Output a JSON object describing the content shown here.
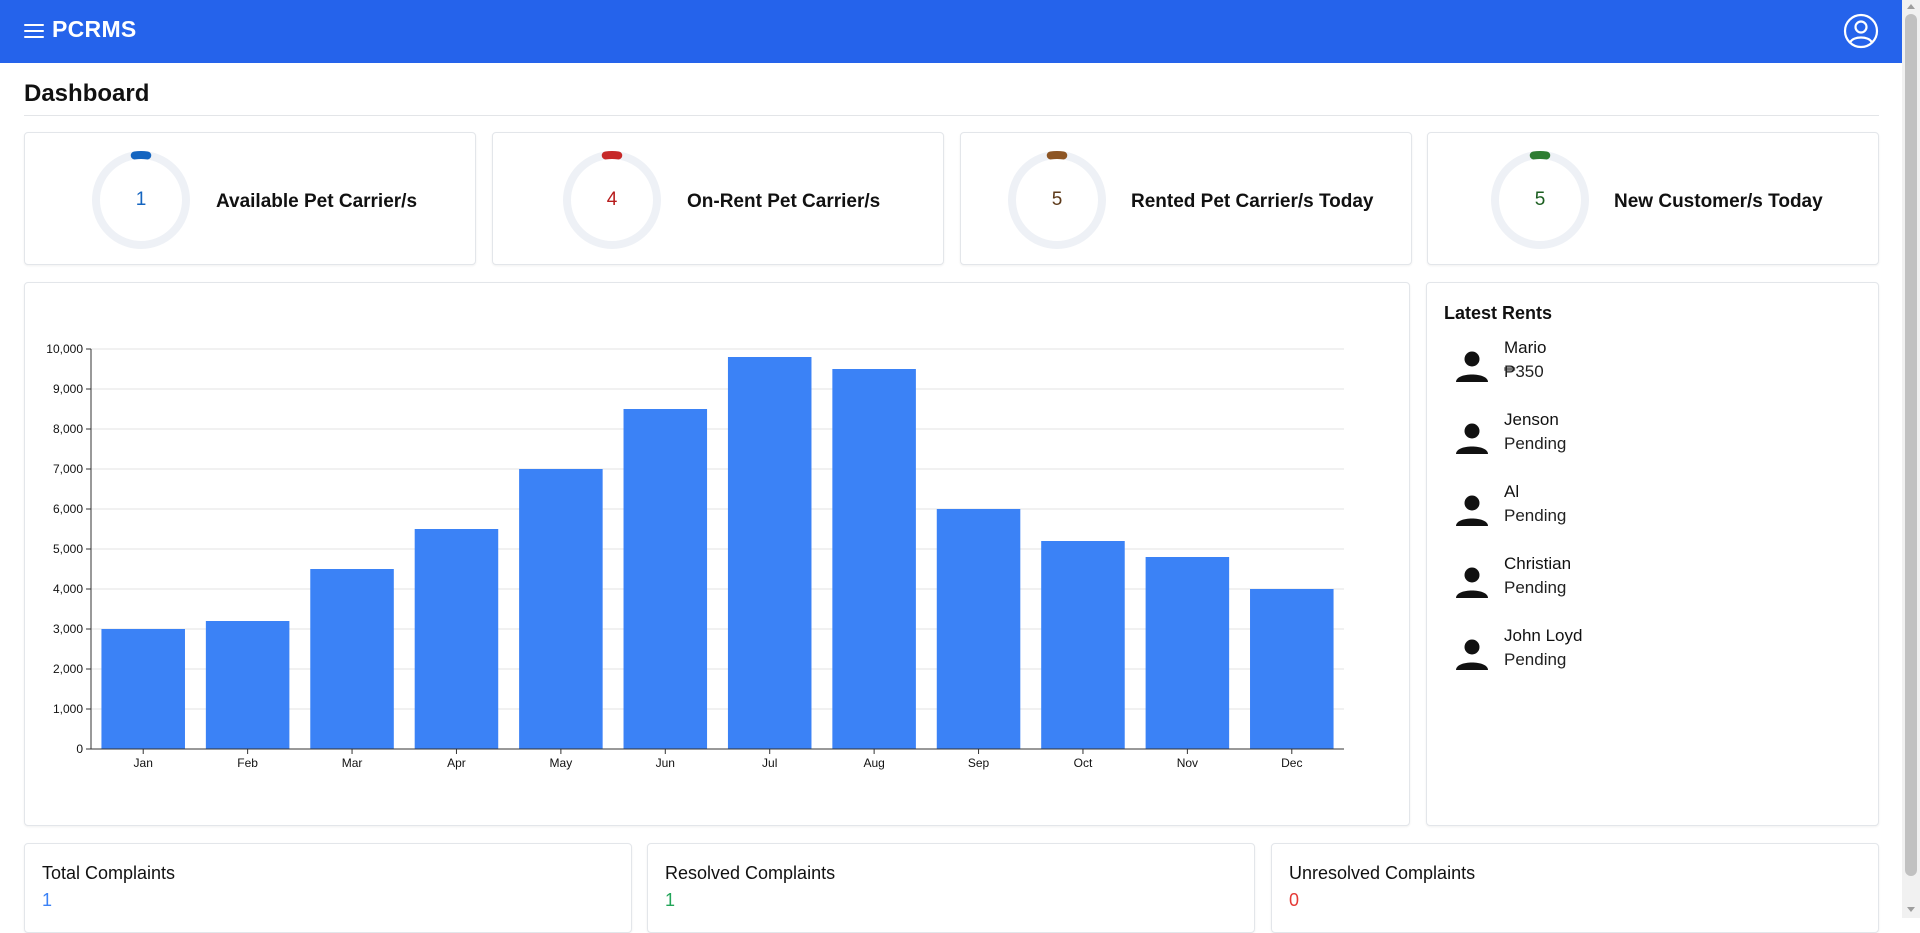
{
  "app": {
    "brand": "PCRMS"
  },
  "page": {
    "title": "Dashboard"
  },
  "stats": [
    {
      "value": "1",
      "label": "Available Pet Carrier/s",
      "color": "#1565c0",
      "arc_color": "#1565c0"
    },
    {
      "value": "4",
      "label": "On-Rent Pet Carrier/s",
      "color": "#b71c1c",
      "arc_color": "#c62828"
    },
    {
      "value": "5",
      "label": "Rented Pet Carrier/s Today",
      "color": "#5d3a1a",
      "arc_color": "#8d5524"
    },
    {
      "value": "5",
      "label": "New Customer/s Today",
      "color": "#1b5e20",
      "arc_color": "#2e7d32"
    }
  ],
  "chart_data": {
    "type": "bar",
    "categories": [
      "Jan",
      "Feb",
      "Mar",
      "Apr",
      "May",
      "Jun",
      "Jul",
      "Aug",
      "Sep",
      "Oct",
      "Nov",
      "Dec"
    ],
    "values": [
      3000,
      3200,
      4500,
      5500,
      7000,
      8500,
      9800,
      9500,
      6000,
      5200,
      4800,
      4000
    ],
    "yticks": [
      0,
      1000,
      2000,
      3000,
      4000,
      5000,
      6000,
      7000,
      8000,
      9000,
      10000
    ],
    "ytick_labels": [
      "0",
      "1,000",
      "2,000",
      "3,000",
      "4,000",
      "5,000",
      "6,000",
      "7,000",
      "8,000",
      "9,000",
      "10,000"
    ],
    "ylim": [
      0,
      10000
    ],
    "title": "",
    "xlabel": "",
    "ylabel": "",
    "grid": true,
    "bar_color": "#3b82f6"
  },
  "latest_rents": {
    "title": "Latest Rents",
    "items": [
      {
        "name": "Mario",
        "status": "₱350"
      },
      {
        "name": "Jenson",
        "status": "Pending"
      },
      {
        "name": "Al",
        "status": "Pending"
      },
      {
        "name": "Christian",
        "status": "Pending"
      },
      {
        "name": "John Loyd",
        "status": "Pending"
      }
    ]
  },
  "complaints": [
    {
      "title": "Total Complaints",
      "value": "1",
      "color": "#3b82f6"
    },
    {
      "title": "Resolved Complaints",
      "value": "1",
      "color": "#22a559"
    },
    {
      "title": "Unresolved Complaints",
      "value": "0",
      "color": "#e53935"
    }
  ]
}
